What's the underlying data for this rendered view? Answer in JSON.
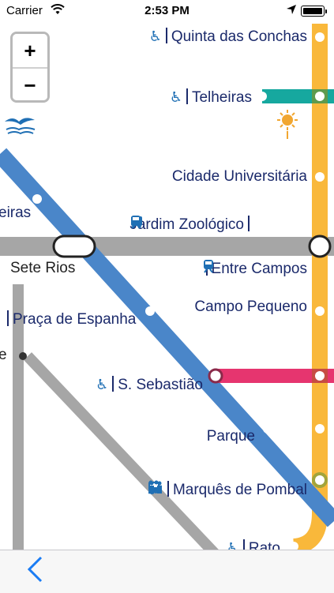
{
  "status_bar": {
    "carrier": "Carrier",
    "time": "2:53 PM",
    "wifi_icon": "wifi-icon",
    "location_icon": "location-arrow-icon",
    "battery_icon": "battery-full-icon"
  },
  "zoom": {
    "in_label": "+",
    "out_label": "−"
  },
  "colors": {
    "yellow_line": "#f9b83b",
    "blue_line": "#4a86c9",
    "green_line": "#16a89f",
    "red_line": "#e6356f",
    "gray_line": "#a6a6a6",
    "label_text": "#1b2a6b",
    "accent": "#1a7cf4"
  },
  "stations": {
    "quinta_das_conchas": "Quinta das Conchas",
    "telheiras": "Telheiras",
    "cidade_universitaria": "Cidade Universitária",
    "laranjeiras_partial": "eiras",
    "jardim_zoologico": "Jardim Zoológico",
    "sete_rios": "Sete Rios",
    "entre_campos": "Entre Campos",
    "campo_pequeno": "Campo Pequeno",
    "praca_de_espanha": "Praça de Espanha",
    "partial_e": "e",
    "s_sebastiao": "S. Sebastião",
    "parque": "Parque",
    "marques_de_pombal": "Marquês de Pombal",
    "rato": "Rato"
  },
  "icons": {
    "accessible": "♿",
    "bus": "🚌",
    "train": "🚆",
    "sep_glyph": ""
  },
  "toolbar": {
    "back_label": "‹"
  }
}
